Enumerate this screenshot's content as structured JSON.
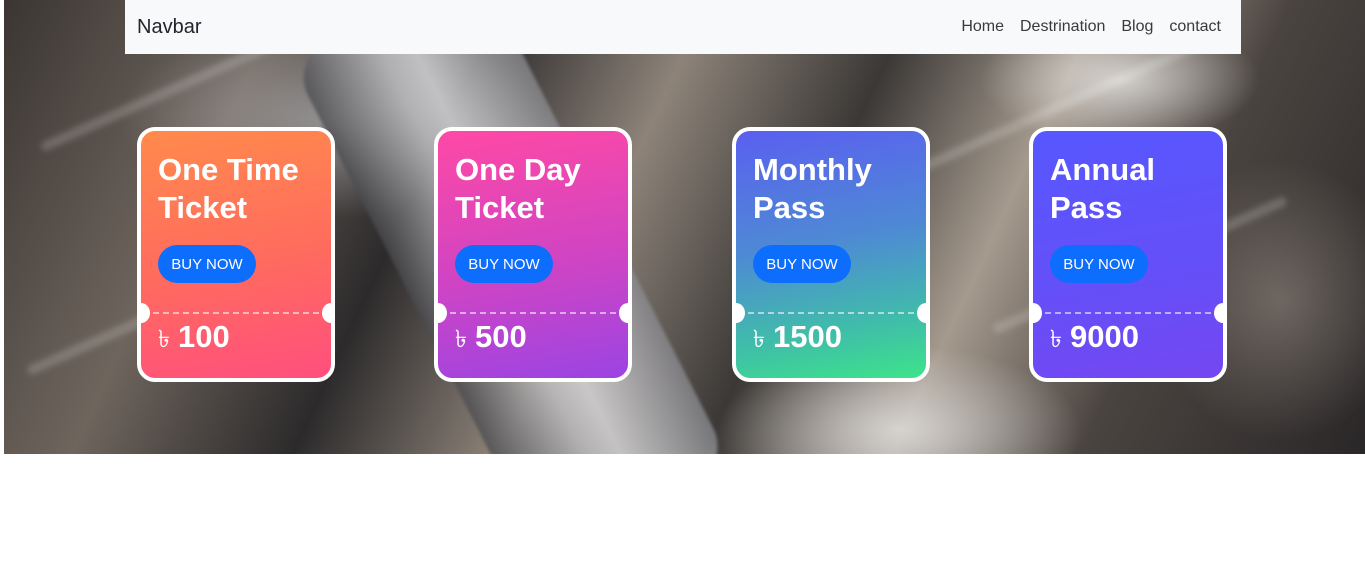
{
  "navbar": {
    "brand": "Navbar",
    "links": [
      "Home",
      "Destrination",
      "Blog",
      "contact"
    ]
  },
  "tickets": [
    {
      "title": "One Time Ticket",
      "button": "BUY NOW",
      "currency": "৳",
      "price": "100"
    },
    {
      "title": "One Day Ticket",
      "button": "BUY NOW",
      "currency": "৳",
      "price": "500"
    },
    {
      "title": "Monthly Pass",
      "button": "BUY NOW",
      "currency": "৳",
      "price": "1500"
    },
    {
      "title": "Annual Pass",
      "button": "BUY NOW",
      "currency": "৳",
      "price": "9000"
    }
  ],
  "colors": {
    "navbar_bg": "#f8f9fa",
    "button_bg": "#0d6efd",
    "card_one_time": [
      "#ff8a4c",
      "#ff4f7e"
    ],
    "card_one_day": [
      "#ff49a5",
      "#9b44e3"
    ],
    "card_monthly": [
      "#5a5ff0",
      "#3ee38a"
    ],
    "card_annual": [
      "#5757ff",
      "#7447f2"
    ]
  }
}
